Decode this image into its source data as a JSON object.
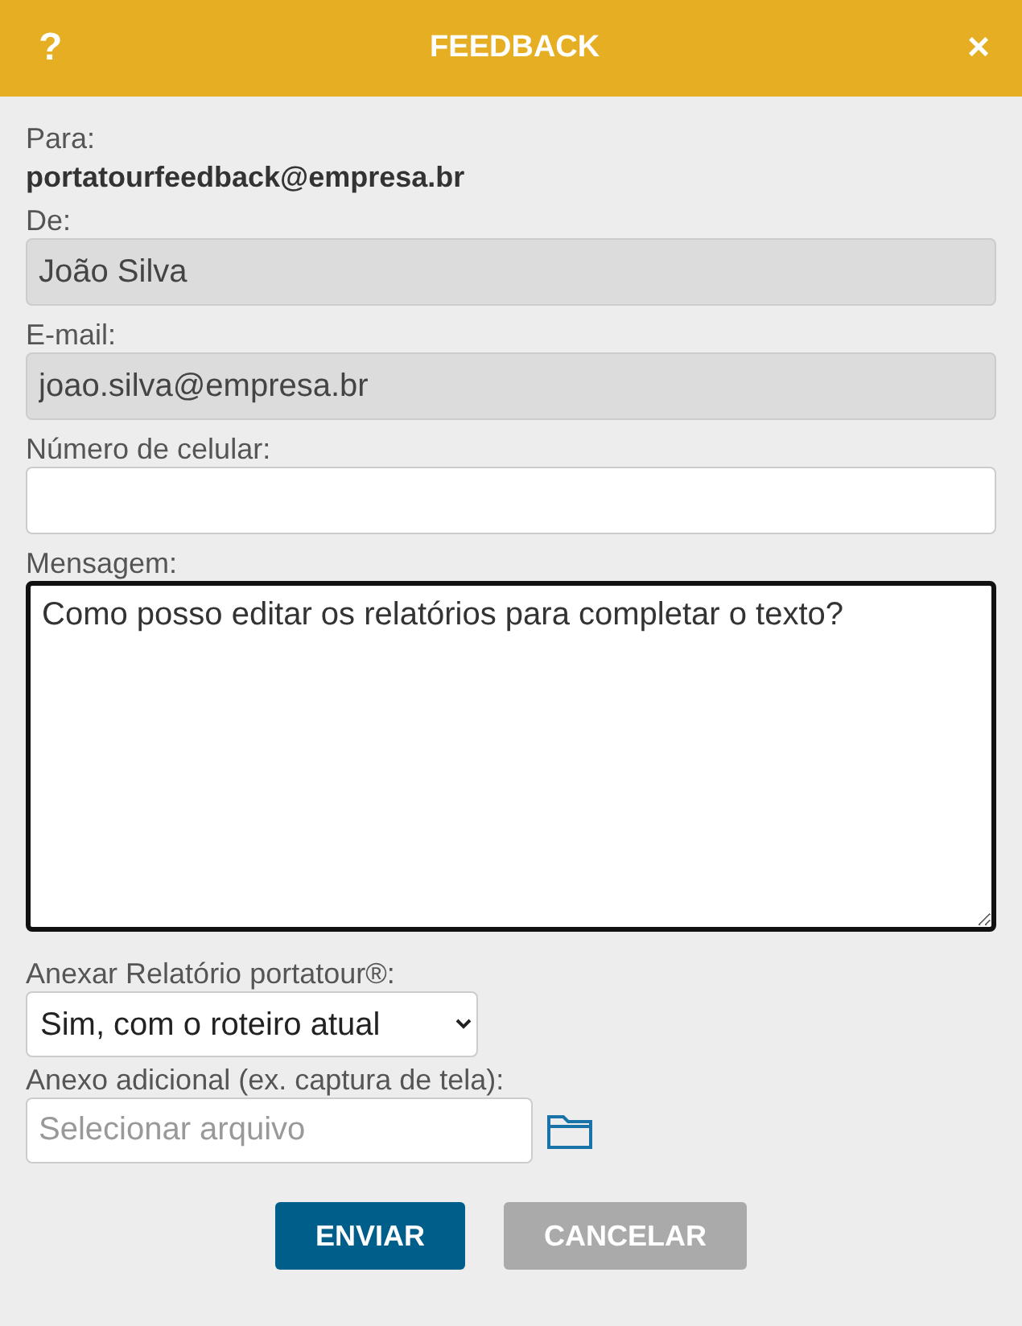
{
  "header": {
    "help": "?",
    "title": "FEEDBACK",
    "close": "×"
  },
  "to": {
    "label": "Para:",
    "value": "portatourfeedback@empresa.br"
  },
  "fields": [
    {
      "kind": "text",
      "label": "De:",
      "value": "João Silva",
      "disabled": true
    },
    {
      "kind": "text",
      "label": "E-mail:",
      "value": "joao.silva@empresa.br",
      "disabled": true
    },
    {
      "kind": "text",
      "label": "Número de celular:",
      "disabled": false
    },
    {
      "kind": "textarea",
      "label": "Mensagem:",
      "value": "Como posso editar os relatórios para completar o texto?",
      "focused": true
    },
    {
      "kind": "select",
      "label": "Anexar Relatório portatour®:",
      "value": "Sim, com o roteiro atual"
    },
    {
      "kind": "file",
      "label": "Anexo adicional (ex. captura de tela):",
      "placeholder": "Selecionar arquivo"
    }
  ],
  "buttons": [
    {
      "label": "ENVIAR",
      "kind": "primary"
    },
    {
      "label": "CANCELAR",
      "kind": "secondary"
    }
  ]
}
